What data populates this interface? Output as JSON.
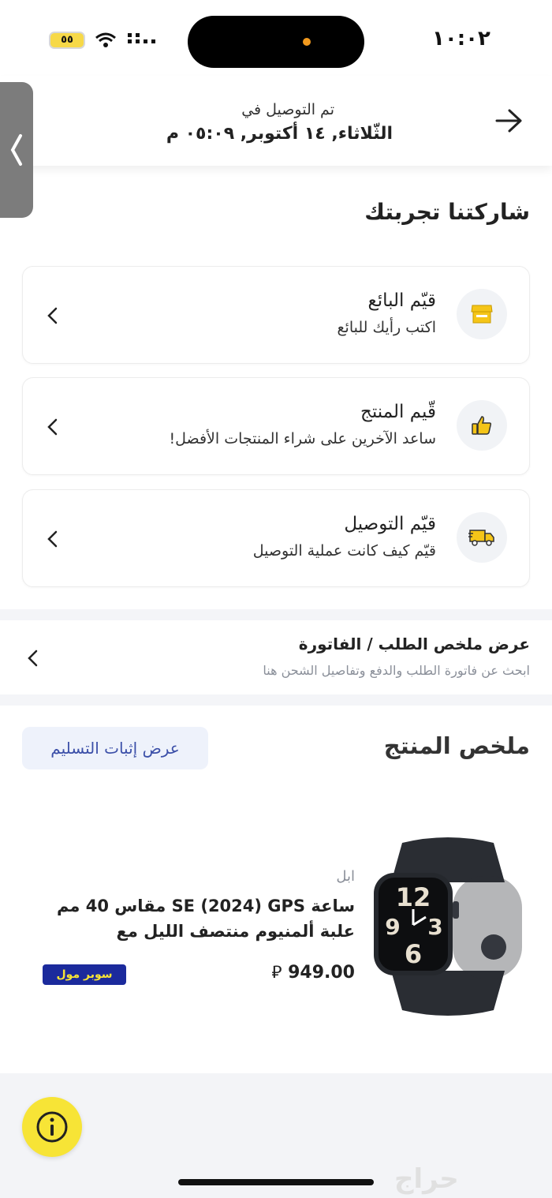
{
  "status_bar": {
    "time": "١٠:٠٢",
    "battery": "٥٥"
  },
  "header": {
    "delivered_label": "تم التوصيل في",
    "delivered_date": "الثّلاثاء, ١٤ أكتوبر, ٠٥:٠٩ م"
  },
  "rating": {
    "title": "شاركتنا تجربتك",
    "cards": [
      {
        "title": "قيّم البائع",
        "subtitle": "اكتب رأيك للبائع",
        "icon": "store-icon"
      },
      {
        "title": "قّيم المنتج",
        "subtitle": "ساعد الآخرين على شراء المنتجات الأفضل!",
        "icon": "thumbs-up-icon"
      },
      {
        "title": "قيّم التوصيل",
        "subtitle": "قيّم كيف كانت عملية التوصيل",
        "icon": "truck-icon"
      }
    ]
  },
  "order_summary": {
    "title": "عرض ملخص الطلب / الفاتورة",
    "subtitle": "ابحث عن فاتورة الطلب والدفع وتفاصيل الشحن هنا"
  },
  "product_summary": {
    "title": "ملخص المنتج",
    "proof_button": "عرض إثبات التسليم",
    "product": {
      "brand": "ابل",
      "name": "ساعة SE (2024) GPS مقاس 40 مم علبة ألمنيوم منتصف الليل مع",
      "price": "949.00",
      "currency_symbol": "⃁",
      "badge": "سوبر مول"
    }
  },
  "watermark": "حراج",
  "colors": {
    "accent_yellow": "#f7e436",
    "badge_blue": "#1b2a9c",
    "link_blue": "#3b4fa8"
  }
}
